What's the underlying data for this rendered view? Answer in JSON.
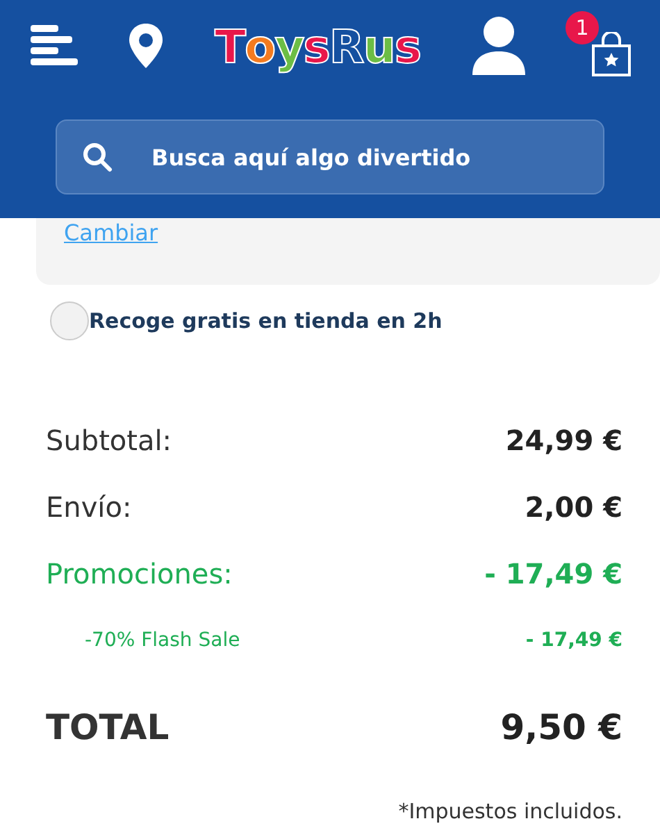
{
  "header": {
    "logo": "ToysRus",
    "cart_count": "1",
    "search": {
      "placeholder": "Busca aquí algo divertido"
    }
  },
  "address_card": {
    "link": "Cambiar"
  },
  "pickup_option": {
    "label": "Recoge gratis en tienda en 2h",
    "checked": false
  },
  "summary": [
    {
      "kind": "normal",
      "label": "Subtotal:",
      "value": "24,99 €"
    },
    {
      "kind": "normal",
      "label": "Envío:",
      "value": "2,00 €"
    },
    {
      "kind": "promo",
      "label": "Promociones:",
      "value": "- 17,49 €"
    },
    {
      "kind": "sub",
      "label": "-70% Flash Sale",
      "value": "- 17,49 €"
    },
    {
      "kind": "total",
      "label": "TOTAL",
      "value": "9,50 €"
    }
  ],
  "tax_note": "*Impuestos incluidos."
}
